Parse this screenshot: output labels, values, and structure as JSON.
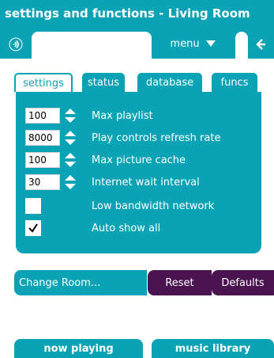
{
  "window": {
    "title": "settings and functions - Living Room"
  },
  "toolbar": {
    "menu_label": "menu"
  },
  "tabs": [
    {
      "label": "settings",
      "active": true
    },
    {
      "label": "status",
      "active": false
    },
    {
      "label": "database",
      "active": false
    },
    {
      "label": "funcs",
      "active": false
    }
  ],
  "settings": {
    "rows": [
      {
        "value": "100",
        "label": "Max playlist"
      },
      {
        "value": "8000",
        "label": "Play controls refresh rate"
      },
      {
        "value": "100",
        "label": "Max picture cache"
      },
      {
        "value": "30",
        "label": "Internet wait interval"
      }
    ],
    "checks": [
      {
        "label": "Low bandwidth network",
        "checked": false
      },
      {
        "label": "Auto show all",
        "checked": true
      }
    ]
  },
  "actions": {
    "change_room": "Change Room...",
    "reset": "Reset",
    "defaults": "Defaults"
  },
  "bottom_tabs": {
    "now_playing": "now playing",
    "music_library": "music library"
  },
  "colors": {
    "accent": "#0aa3b5",
    "action_dark": "#4a1450"
  },
  "icons": {
    "speaker": "speaker-icon",
    "back": "back-arrow-icon",
    "menu_caret": "caret-down-icon",
    "spin": "spinner-arrows-icon"
  }
}
